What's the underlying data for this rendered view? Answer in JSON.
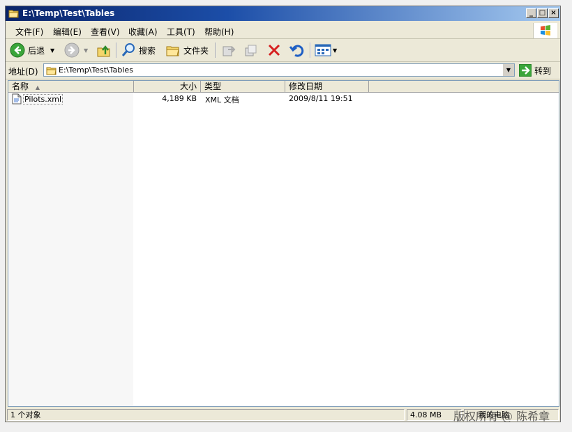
{
  "window": {
    "title": "E:\\Temp\\Test\\Tables"
  },
  "menu": {
    "items": [
      "文件(F)",
      "编辑(E)",
      "查看(V)",
      "收藏(A)",
      "工具(T)",
      "帮助(H)"
    ]
  },
  "toolbar": {
    "back_label": "后退",
    "search_label": "搜索",
    "folders_label": "文件夹"
  },
  "address": {
    "label": "地址(D)",
    "value": "E:\\Temp\\Test\\Tables",
    "go_label": "转到"
  },
  "list": {
    "columns": [
      "名称",
      "大小",
      "类型",
      "修改日期"
    ],
    "rows": [
      {
        "name": "Pilots.xml",
        "size": "4,189 KB",
        "type": "XML 文档",
        "modified": "2009/8/11 19:51"
      }
    ]
  },
  "status": {
    "objects": "1 个对象",
    "size": "4.08 MB",
    "location": "我的电脑"
  },
  "watermark": "版权所有 @ 陈希章"
}
